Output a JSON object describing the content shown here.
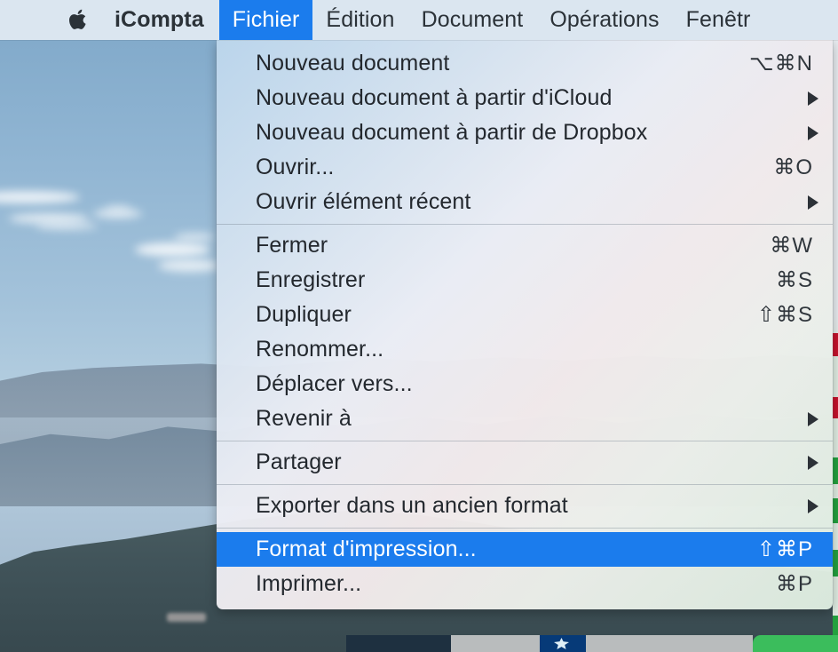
{
  "menubar": {
    "apple_icon": "apple-logo-icon",
    "items": [
      {
        "label": "iCompta",
        "name": "app-name",
        "bold": true,
        "active": false
      },
      {
        "label": "Fichier",
        "name": "menu-fichier",
        "bold": false,
        "active": true
      },
      {
        "label": "Édition",
        "name": "menu-edition",
        "bold": false,
        "active": false
      },
      {
        "label": "Document",
        "name": "menu-document",
        "bold": false,
        "active": false
      },
      {
        "label": "Opérations",
        "name": "menu-operations",
        "bold": false,
        "active": false
      },
      {
        "label": "Fenêtr",
        "name": "menu-fenetre",
        "bold": false,
        "active": false
      }
    ]
  },
  "menu_panel": {
    "title": "Fichier",
    "groups": [
      {
        "items": [
          {
            "label": "Nouveau document",
            "shortcut": "⌥⌘N",
            "submenu": false,
            "selected": false
          },
          {
            "label": "Nouveau document à partir d'iCloud",
            "shortcut": "",
            "submenu": true,
            "selected": false
          },
          {
            "label": "Nouveau document à partir de Dropbox",
            "shortcut": "",
            "submenu": true,
            "selected": false
          },
          {
            "label": "Ouvrir...",
            "shortcut": "⌘O",
            "submenu": false,
            "selected": false
          },
          {
            "label": "Ouvrir élément récent",
            "shortcut": "",
            "submenu": true,
            "selected": false
          }
        ]
      },
      {
        "items": [
          {
            "label": "Fermer",
            "shortcut": "⌘W",
            "submenu": false,
            "selected": false
          },
          {
            "label": "Enregistrer",
            "shortcut": "⌘S",
            "submenu": false,
            "selected": false
          },
          {
            "label": "Dupliquer",
            "shortcut": "⇧⌘S",
            "submenu": false,
            "selected": false
          },
          {
            "label": "Renommer...",
            "shortcut": "",
            "submenu": false,
            "selected": false
          },
          {
            "label": "Déplacer vers...",
            "shortcut": "",
            "submenu": false,
            "selected": false
          },
          {
            "label": "Revenir à",
            "shortcut": "",
            "submenu": true,
            "selected": false
          }
        ]
      },
      {
        "items": [
          {
            "label": "Partager",
            "shortcut": "",
            "submenu": true,
            "selected": false
          }
        ]
      },
      {
        "items": [
          {
            "label": "Exporter dans un ancien format",
            "shortcut": "",
            "submenu": true,
            "selected": false
          }
        ]
      },
      {
        "items": [
          {
            "label": "Format d'impression...",
            "shortcut": "⇧⌘P",
            "submenu": false,
            "selected": true
          },
          {
            "label": "Imprimer...",
            "shortcut": "⌘P",
            "submenu": false,
            "selected": false
          }
        ]
      }
    ]
  },
  "colors": {
    "menubar_bg": "#dbe6f0",
    "highlight_blue": "#1b7ced",
    "highlight_text": "#ffffff",
    "menu_text": "#23282e",
    "separator": "#78848f",
    "badge_red": "#c5112b",
    "badge_green": "#23a03e",
    "dock_green": "#3bbd5c"
  },
  "desktop": {
    "wallpaper": "mountain-sky-landscape"
  }
}
